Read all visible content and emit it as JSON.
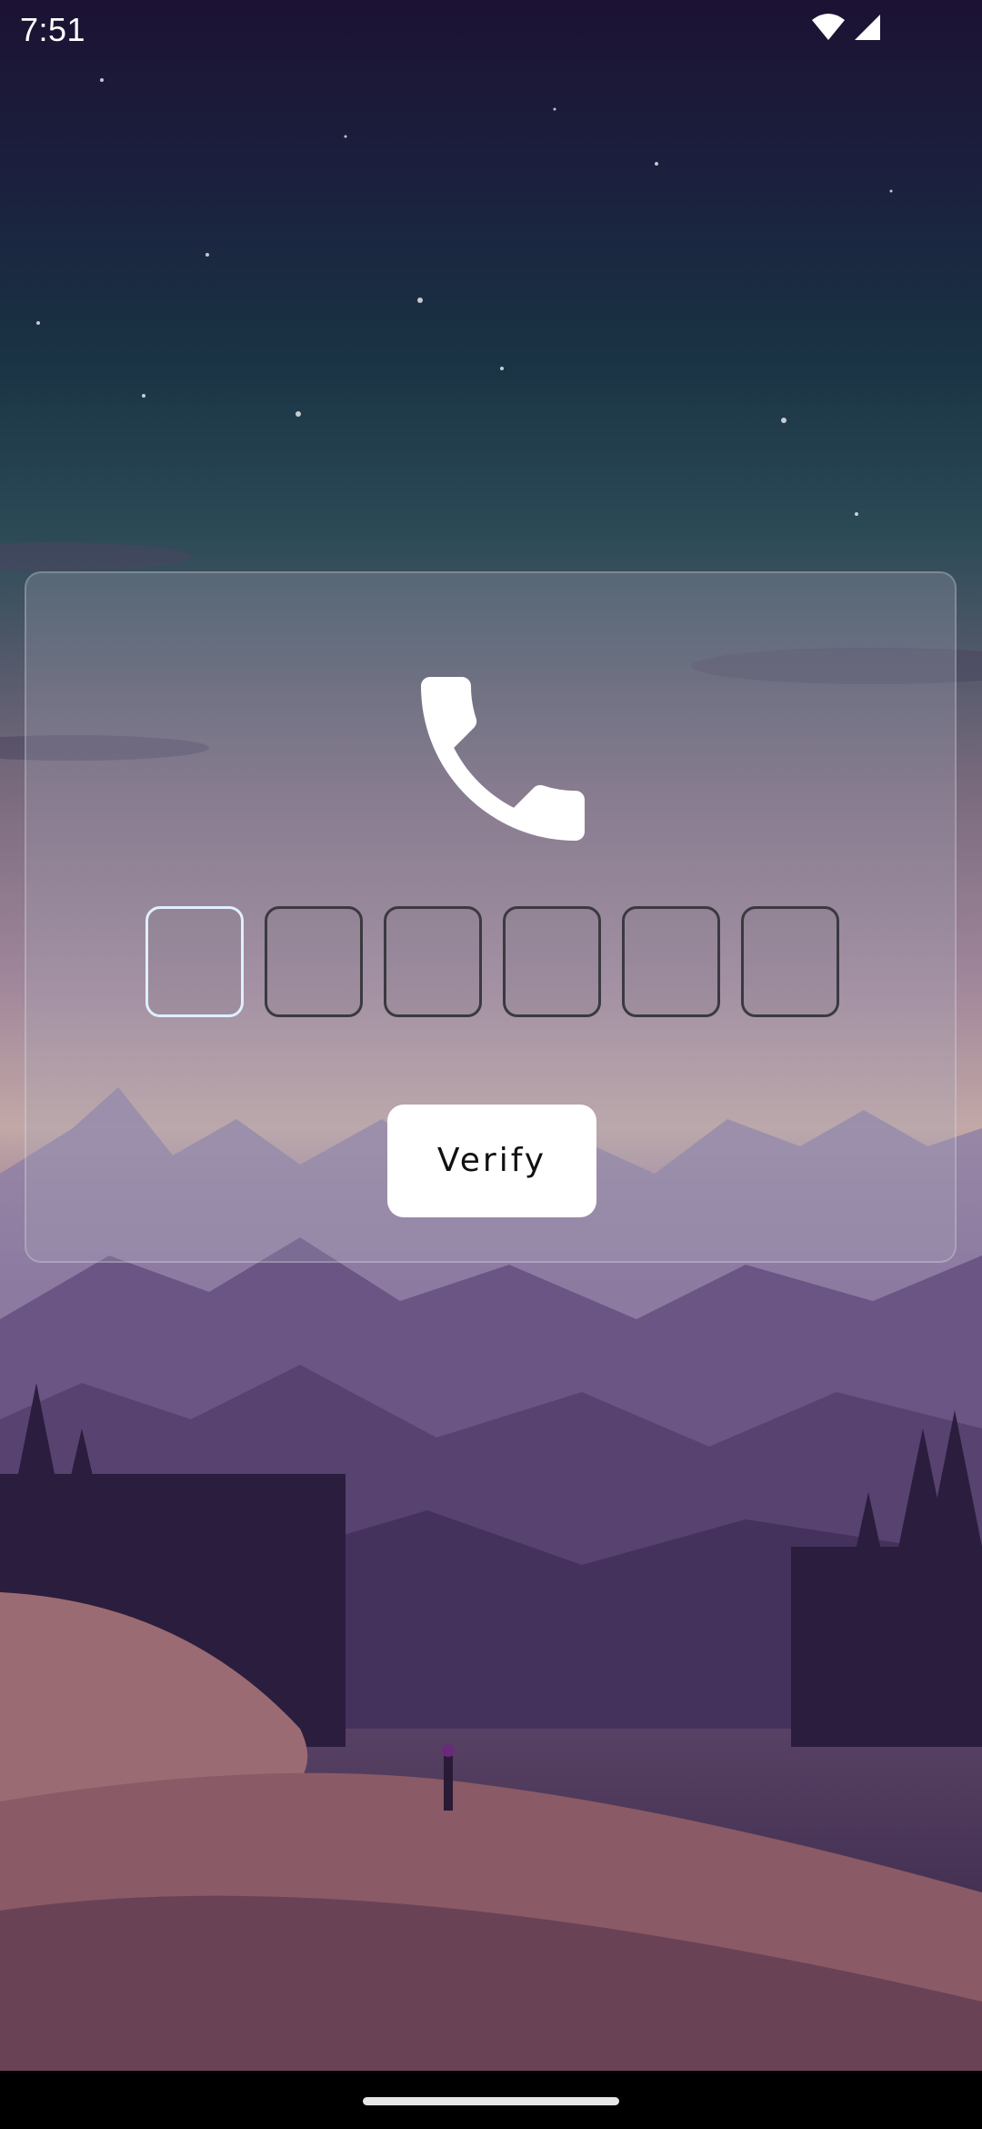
{
  "status_bar": {
    "time": "7:51",
    "icons": [
      "wifi-icon",
      "cellular-signal-icon"
    ]
  },
  "otp_card": {
    "icon": "phone-icon",
    "digits": [
      "",
      "",
      "",
      "",
      "",
      ""
    ],
    "focused_index": 0,
    "verify_label": "Verify"
  },
  "colors": {
    "button_background": "#ffffff",
    "focused_border": "#dff0ff",
    "box_border": "#3a3a40"
  }
}
